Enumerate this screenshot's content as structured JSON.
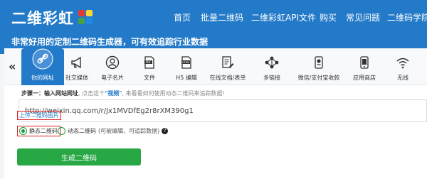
{
  "header": {
    "logo_text": "二维彩虹",
    "tagline": "非常好用的定制二维码生成器，可有效追踪行业数据",
    "nav": [
      "首页",
      "批量二维码",
      "二维彩虹API文件",
      "购买",
      "常见问题",
      "二维码学院"
    ]
  },
  "tabs": [
    {
      "label": "你的网址",
      "icon": "link-icon",
      "active": true
    },
    {
      "label": "社交媒体",
      "icon": "megaphone-icon"
    },
    {
      "label": "电子名片",
      "icon": "contact-card-icon"
    },
    {
      "label": "文件",
      "icon": "pdf-file-icon"
    },
    {
      "label": "H5 编辑",
      "icon": "html-file-icon"
    },
    {
      "label": "在线文档/表单",
      "icon": "document-edit-icon"
    },
    {
      "label": "多链接",
      "icon": "multi-link-icon"
    },
    {
      "label": "微信/支付宝收款",
      "icon": "wallet-icon"
    },
    {
      "label": "应用商店",
      "icon": "app-store-icon"
    },
    {
      "label": "无线",
      "icon": "wifi-icon"
    }
  ],
  "form": {
    "step_label": "步骤一：输入网站网址",
    "step_hint_pre": ", 点击这个",
    "step_link": "\"视频\"",
    "step_hint_post": ", 来看看如何使用动态二维码来追踪数据!",
    "url_value": "http://weixin.qq.com/r/Jx1MVDfEg2r8rXM390g1",
    "upload_label": "上传二维码图片",
    "static_label": "静态二维码",
    "dynamic_label": "动态二维码",
    "dynamic_hint": "(可被编辑，可追踪数据)",
    "help_icon": "help-icon",
    "generate_label": "生成二维码"
  },
  "colors": {
    "brand_blue": "#237ac8",
    "generate_green": "#28a745",
    "highlight_red": "#e02020"
  }
}
